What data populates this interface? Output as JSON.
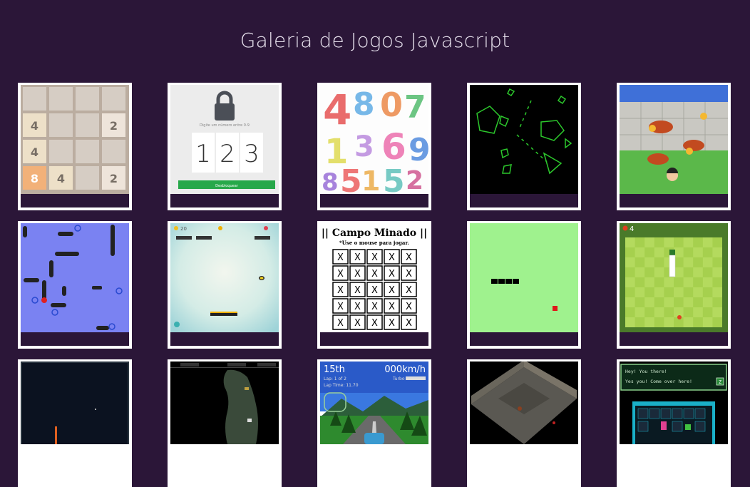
{
  "page": {
    "title": "Galeria de Jogos Javascript"
  },
  "colors": {
    "background": "#2b1638",
    "card_border": "#ffffff",
    "title_text": "#e8e2ee"
  },
  "games": [
    {
      "thumb": "2048-board",
      "tiles": [
        "",
        "",
        "",
        "",
        "4",
        "",
        "",
        "2",
        "4",
        "",
        "",
        "",
        "8",
        "4",
        "",
        "2"
      ]
    },
    {
      "thumb": "lock-code",
      "prompt": "Digite um número entre 0-9",
      "digits": [
        "1",
        "2",
        "3"
      ],
      "button": "Desbloquear"
    },
    {
      "thumb": "colored-numbers",
      "numbers": [
        "4",
        "8",
        "0",
        "7",
        "1",
        "3",
        "6",
        "9",
        "8",
        "5",
        "1",
        "5",
        "2"
      ]
    },
    {
      "thumb": "asteroids"
    },
    {
      "thumb": "frogger-bugs"
    },
    {
      "thumb": "battleship"
    },
    {
      "thumb": "breakout",
      "score": "20"
    },
    {
      "thumb": "minesweeper",
      "header": "|| Campo Minado ||",
      "instructions": "*Use o mouse para jogar.",
      "cell": "X"
    },
    {
      "thumb": "snake-light"
    },
    {
      "thumb": "snake-grass",
      "score": "4"
    },
    {
      "thumb": "space-night"
    },
    {
      "thumb": "cave-dungeon"
    },
    {
      "thumb": "racing",
      "position": "15th",
      "speed": "000km/h",
      "lap": "Lap: 1 of 2",
      "lap_time": "Lap Time: 11.70",
      "turbo": "Turbo"
    },
    {
      "thumb": "isometric-dungeon"
    },
    {
      "thumb": "rpg-dialog",
      "dialog_line1": "Hey! You there!",
      "dialog_line2": "Yes you! Come over here!",
      "key": "Z"
    }
  ]
}
